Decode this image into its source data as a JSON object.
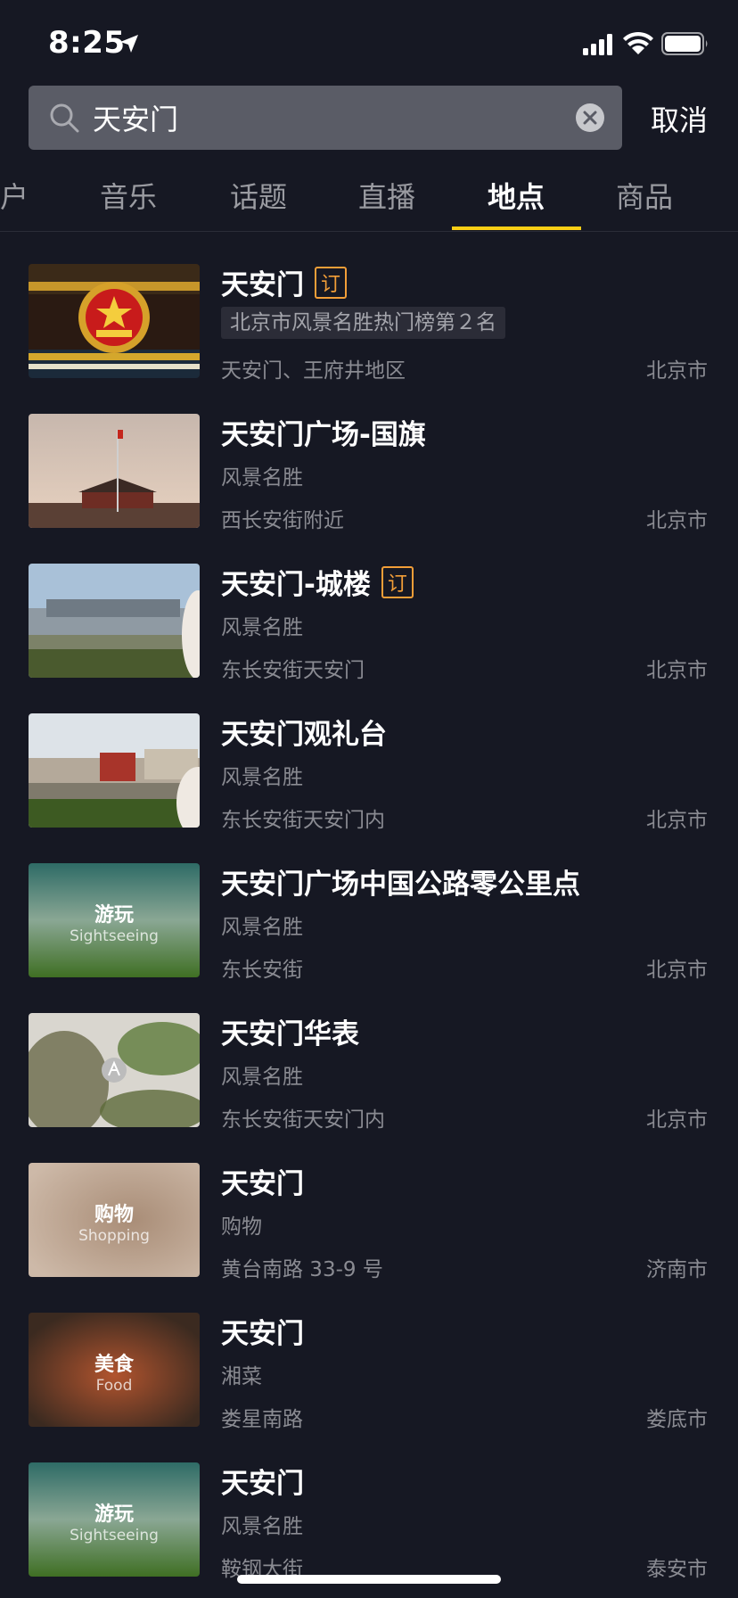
{
  "status": {
    "time": "8:25"
  },
  "search": {
    "query": "天安门",
    "cancel": "取消"
  },
  "tabs": [
    {
      "label": "户"
    },
    {
      "label": "音乐"
    },
    {
      "label": "话题"
    },
    {
      "label": "直播"
    },
    {
      "label": "地点",
      "active": true
    },
    {
      "label": "商品"
    }
  ],
  "results": [
    {
      "title": "天安门",
      "badge": "订",
      "rank": "北京市风景名胜热门榜第２名",
      "address": "天安门、王府井地区",
      "city": "北京市"
    },
    {
      "title": "天安门广场-国旗",
      "category": "风景名胜",
      "address": "西长安街附近",
      "city": "北京市"
    },
    {
      "title": "天安门-城楼",
      "badge": "订",
      "category": "风景名胜",
      "address": "东长安街天安门",
      "city": "北京市"
    },
    {
      "title": "天安门观礼台",
      "category": "风景名胜",
      "address": "东长安街天安门内",
      "city": "北京市"
    },
    {
      "title": "天安门广场中国公路零公里点",
      "category": "风景名胜",
      "address": "东长安街",
      "city": "北京市",
      "thumb_label": "游玩",
      "thumb_sub": "Sightseeing"
    },
    {
      "title": "天安门华表",
      "category": "风景名胜",
      "address": "东长安街天安门内",
      "city": "北京市"
    },
    {
      "title": "天安门",
      "category": "购物",
      "address": "黄台南路 33-9 号",
      "city": "济南市",
      "thumb_label": "购物",
      "thumb_sub": "Shopping"
    },
    {
      "title": "天安门",
      "category": "湘菜",
      "address": "娄星南路",
      "city": "娄底市",
      "thumb_label": "美食",
      "thumb_sub": "Food"
    },
    {
      "title": "天安门",
      "category": "风景名胜",
      "address": "鞍钢大街",
      "city": "泰安市",
      "thumb_label": "游玩",
      "thumb_sub": "Sightseeing"
    }
  ],
  "colors": {
    "background": "#161823",
    "accent": "#face15",
    "badge": "#f29e38"
  }
}
